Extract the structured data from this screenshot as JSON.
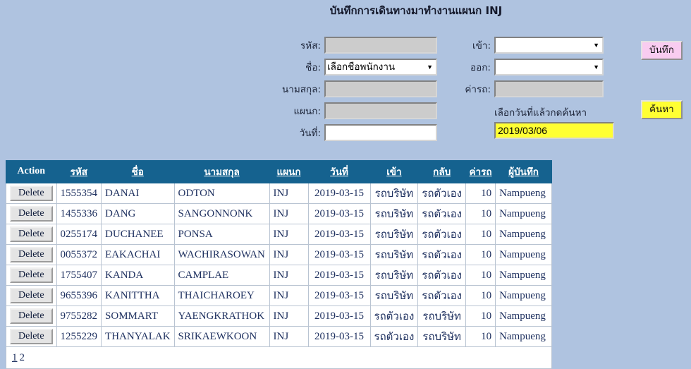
{
  "header": {
    "title": "บันทึกการเดินทางมาทำงานแผนก INJ"
  },
  "form": {
    "left": [
      {
        "label": "รหัส:",
        "type": "text",
        "value": "",
        "disabled": true
      },
      {
        "label": "ชื่อ:",
        "type": "select",
        "value": "เลือกชื่อพนักงาน"
      },
      {
        "label": "นามสกุล:",
        "type": "text",
        "value": "",
        "disabled": true
      },
      {
        "label": "แผนก:",
        "type": "text",
        "value": "",
        "disabled": true
      },
      {
        "label": "วันที่:",
        "type": "text",
        "value": "",
        "disabled": false
      }
    ],
    "right": [
      {
        "label": "เข้า:",
        "type": "select",
        "value": ""
      },
      {
        "label": "ออก:",
        "type": "select",
        "value": ""
      },
      {
        "label": "ค่ารถ:",
        "type": "text",
        "value": "",
        "disabled": true
      }
    ],
    "labels": {
      "code": "รหัส:",
      "name": "ชื่อ:",
      "surname": "นามสกุล:",
      "department": "แผนก:",
      "date": "วันที่:",
      "checkin": "เข้า:",
      "checkout": "ออก:",
      "fare": "ค่ารถ:"
    },
    "values": {
      "code": "",
      "name_option": "เลือกชื่อพนักงาน",
      "surname": "",
      "department": "",
      "date": "",
      "checkin": "",
      "checkout": "",
      "fare": ""
    },
    "search_hint": "เลือกวันที่แล้วกดค้นหา",
    "search_date": "2019/03/06"
  },
  "buttons": {
    "save": "บันทึก",
    "search": "ค้นหา",
    "delete": "Delete"
  },
  "colors": {
    "page_background": "#afc3e0",
    "table_header": "#15628f",
    "save_button": "#f9ccf0",
    "search_button": "#ffff33",
    "date_field": "#ffff33",
    "cell_text": "#1f3160"
  },
  "table": {
    "columns": [
      "Action",
      "รหัส",
      "ชื่อ",
      "นามสกุล",
      "แผนก",
      "วันที่",
      "เข้า",
      "กลับ",
      "ค่ารถ",
      "ผู้บันทึก"
    ],
    "rows": [
      {
        "code": "1555354",
        "name": "DANAI",
        "surname": "ODTON",
        "dept": "INJ",
        "date": "2019-03-15",
        "in": "รถบริษัท",
        "back": "รถตัวเอง",
        "fare": "10",
        "recorder": "Nampueng"
      },
      {
        "code": "1455336",
        "name": "DANG",
        "surname": "SANGONNONK",
        "dept": "INJ",
        "date": "2019-03-15",
        "in": "รถบริษัท",
        "back": "รถตัวเอง",
        "fare": "10",
        "recorder": "Nampueng"
      },
      {
        "code": "0255174",
        "name": "DUCHANEE",
        "surname": "PONSA",
        "dept": "INJ",
        "date": "2019-03-15",
        "in": "รถบริษัท",
        "back": "รถตัวเอง",
        "fare": "10",
        "recorder": "Nampueng"
      },
      {
        "code": "0055372",
        "name": "EAKACHAI",
        "surname": "WACHIRASOWAN",
        "dept": "INJ",
        "date": "2019-03-15",
        "in": "รถบริษัท",
        "back": "รถตัวเอง",
        "fare": "10",
        "recorder": "Nampueng"
      },
      {
        "code": "1755407",
        "name": "KANDA",
        "surname": "CAMPLAE",
        "dept": "INJ",
        "date": "2019-03-15",
        "in": "รถบริษัท",
        "back": "รถตัวเอง",
        "fare": "10",
        "recorder": "Nampueng"
      },
      {
        "code": "9655396",
        "name": "KANITTHA",
        "surname": "THAICHAROEY",
        "dept": "INJ",
        "date": "2019-03-15",
        "in": "รถบริษัท",
        "back": "รถตัวเอง",
        "fare": "10",
        "recorder": "Nampueng"
      },
      {
        "code": "9755282",
        "name": "SOMMART",
        "surname": "YAENGKRATHOK",
        "dept": "INJ",
        "date": "2019-03-15",
        "in": "รถตัวเอง",
        "back": "รถบริษัท",
        "fare": "10",
        "recorder": "Nampueng"
      },
      {
        "code": "1255229",
        "name": "THANYALAK",
        "surname": "SRIKAEWKOON",
        "dept": "INJ",
        "date": "2019-03-15",
        "in": "รถตัวเอง",
        "back": "รถบริษัท",
        "fare": "10",
        "recorder": "Nampueng"
      }
    ]
  },
  "pagination": {
    "current": "1",
    "next": "2"
  },
  "icons": {
    "dropdown": "▼"
  }
}
